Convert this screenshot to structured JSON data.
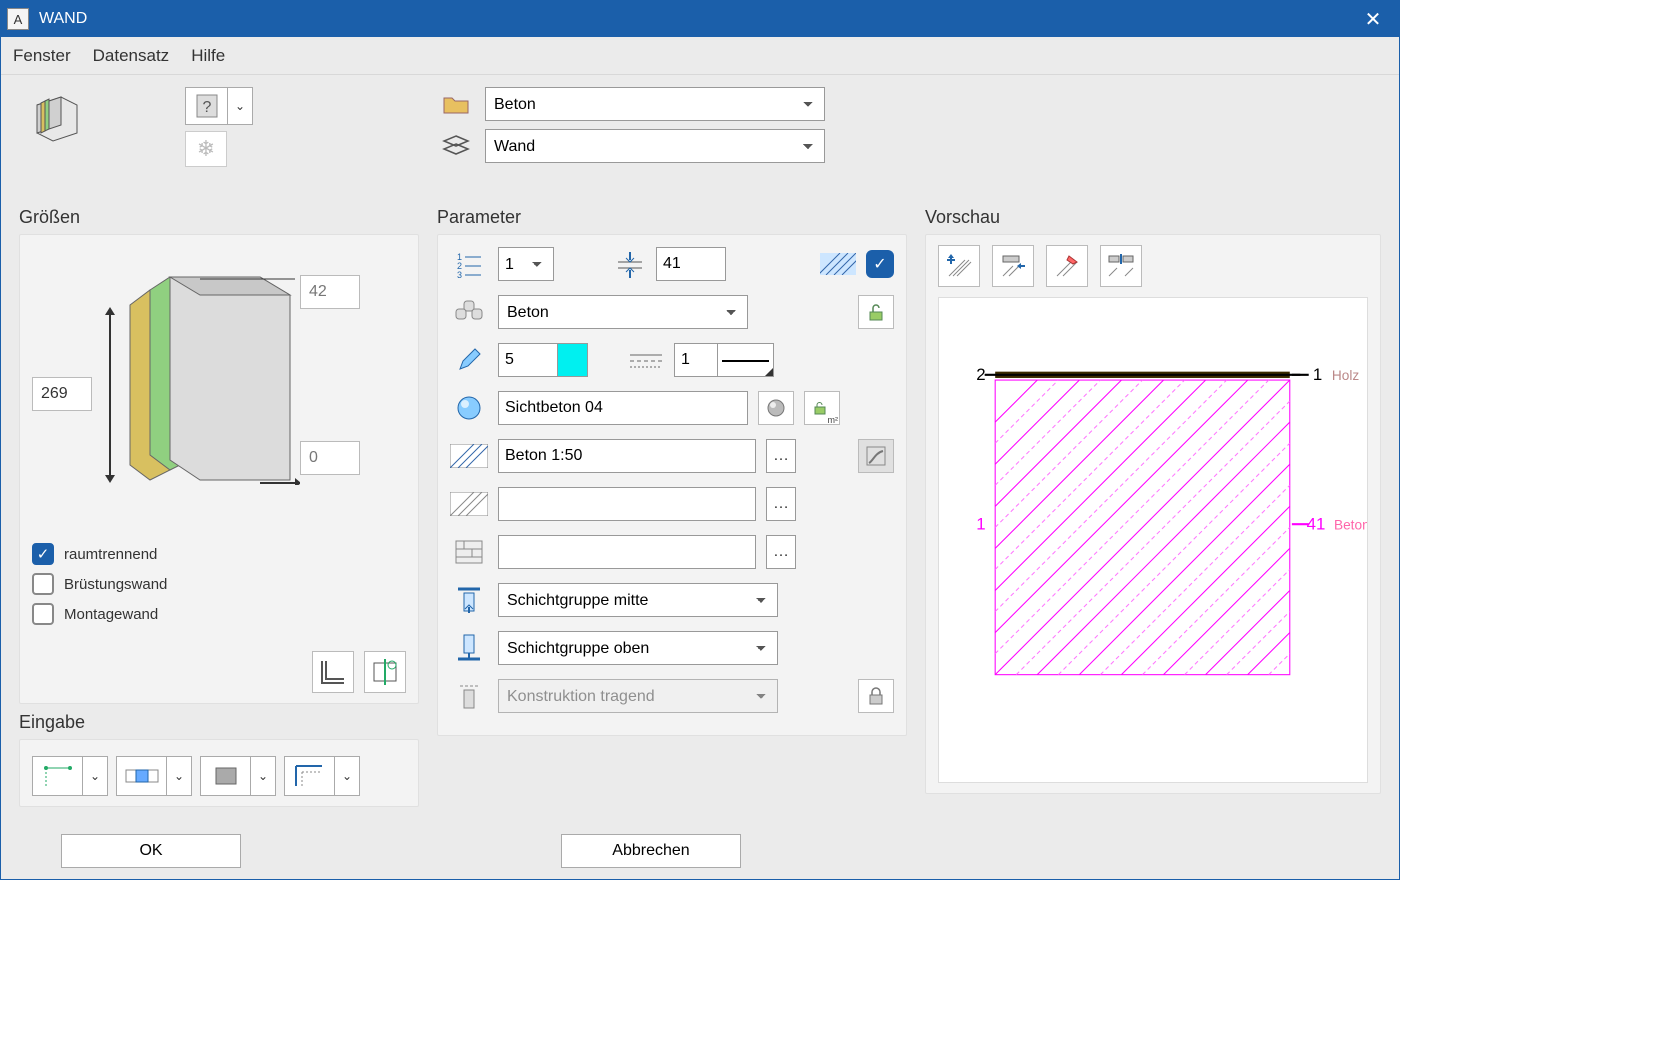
{
  "title": "WAND",
  "menu": {
    "fenster": "Fenster",
    "datensatz": "Datensatz",
    "hilfe": "Hilfe"
  },
  "top": {
    "category": "Beton",
    "type": "Wand"
  },
  "sizes": {
    "title": "Größen",
    "height": "269",
    "width": "42",
    "offset": "0",
    "raumtrennend": "raumtrennend",
    "bruestung": "Brüstungswand",
    "montage": "Montagewand"
  },
  "eingabe": {
    "title": "Eingabe"
  },
  "param": {
    "title": "Parameter",
    "layer_index": "1",
    "thickness": "41",
    "material": "Beton",
    "pen": "5",
    "line": "1",
    "surface": "Sichtbeton 04",
    "hatch1": "Beton 1:50",
    "hatch2": "",
    "hatch3": "",
    "group_h": "Schichtgruppe mitte",
    "group_v": "Schichtgruppe oben",
    "construction": "Konstruktion tragend"
  },
  "preview": {
    "title": "Vorschau",
    "label_left_top": "2",
    "label_left_mid": "1",
    "label_right_top_num": "1",
    "label_right_top_mat": "Holz",
    "label_right_mid_num": "41",
    "label_right_mid_mat": "Beton"
  },
  "footer": {
    "ok": "OK",
    "cancel": "Abbrechen"
  }
}
